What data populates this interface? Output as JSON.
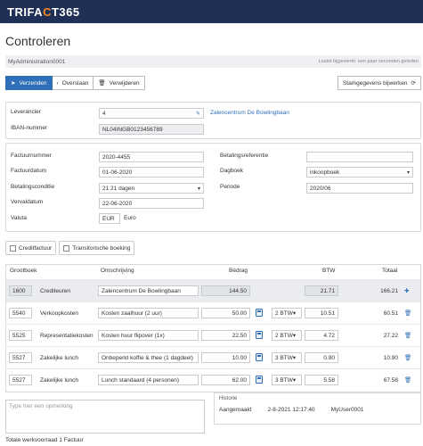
{
  "app": {
    "logo_pre": "TRIFA",
    "logo_accent": "C",
    "logo_post": "T365"
  },
  "page": {
    "title": "Controleren"
  },
  "admin": {
    "name": "MyAdministration0001",
    "updated": "Laatst bijgewerkt: een paar seconden geleden"
  },
  "toolbar": {
    "send": "Verzenden",
    "skip": "Overslaan",
    "delete": "Verwijderen",
    "master": "Stamgegevens bijwerken"
  },
  "supplier": {
    "label": "Leverancier",
    "value": "4",
    "name": "Zalencentrum De Bowlingbaan",
    "iban_label": "IBAN-nummer",
    "iban": "NL04INGB0123456789"
  },
  "invoice": {
    "number_label": "Factuurnummer",
    "number": "2020-4455",
    "date_label": "Factuurdatum",
    "date": "01-06-2020",
    "terms_label": "Betalingsconditie",
    "terms": "21 21 dagen",
    "due_label": "Vervaldatum",
    "due": "22-06-2020",
    "currency_label": "Valuta",
    "currency": "EUR",
    "currency_name": "Euro",
    "payref_label": "Betalingsreferentie",
    "payref": "",
    "journal_label": "Dagboek",
    "journal": "inkoopboek",
    "period_label": "Periode",
    "period": "2020/06"
  },
  "options": {
    "credit": "Creditfactuur",
    "transitory": "Transitorische boeking"
  },
  "table": {
    "headers": {
      "ledger": "Grootboek",
      "desc": "Omschrijving",
      "amount": "Bedrag",
      "vat": "BTW",
      "total": "Totaal"
    },
    "rows": [
      {
        "code": "1600",
        "name": "Crediteuren",
        "desc": "Zalencentrum De Bowlingbaan",
        "amount": "144.50",
        "vatcode": "",
        "vat": "21.71",
        "total": "166.21"
      },
      {
        "code": "5540",
        "name": "Verkoopkosten",
        "desc": "Kosten zaalhuur (2 uur)",
        "amount": "50.00",
        "vatcode": "2 BTW",
        "vat": "10.51",
        "total": "60.51"
      },
      {
        "code": "5525",
        "name": "Representatiekosten",
        "desc": "Kosten huur flipover (1x)",
        "amount": "22.50",
        "vatcode": "2 BTW",
        "vat": "4.72",
        "total": "27.22"
      },
      {
        "code": "5527",
        "name": "Zakelijke lunch",
        "desc": "Onbeperkt koffie & thee (1 dagdeel)",
        "amount": "10.00",
        "vatcode": "3 BTW",
        "vat": "0.90",
        "total": "10.90"
      },
      {
        "code": "5527",
        "name": "Zakelijke lunch",
        "desc": "Lunch standaard (4 personen)",
        "amount": "62.00",
        "vatcode": "3 BTW",
        "vat": "5.58",
        "total": "67.58"
      }
    ]
  },
  "remark": {
    "placeholder": "Type hier een opmerking"
  },
  "history": {
    "title": "Historie",
    "action": "Aangemaakt",
    "when": "2-8-2021 12:17:40",
    "user": "MyUser0001"
  },
  "footer": {
    "text": "Totale werkvoorraad 1 Factuur"
  },
  "colors": {
    "brand": "#1f2f56",
    "accent": "#f08a24",
    "primary": "#2f6fb7"
  },
  "icons": [
    "send-icon",
    "chevron-right-icon",
    "trash-icon",
    "refresh-icon",
    "pencil-icon",
    "plus-icon",
    "calculator-icon",
    "caret-down-icon"
  ]
}
